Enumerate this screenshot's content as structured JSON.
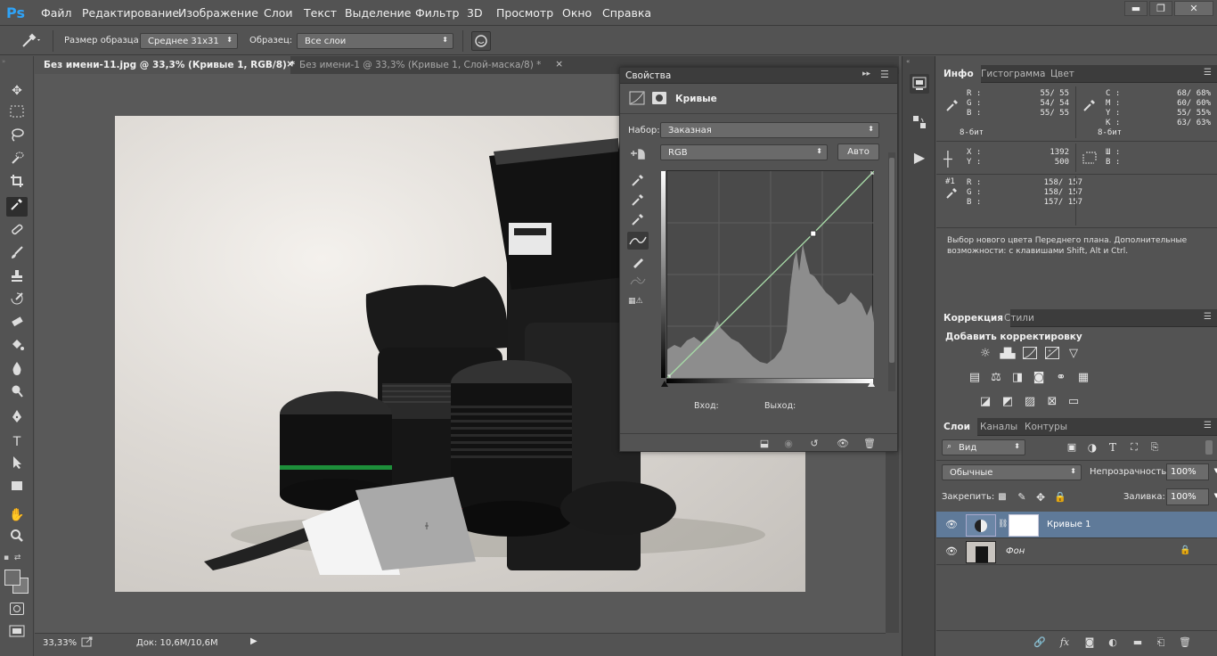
{
  "app": {
    "logo": "Ps"
  },
  "menu": [
    "Файл",
    "Редактирование",
    "Изображение",
    "Слои",
    "Текст",
    "Выделение",
    "Фильтр",
    "3D",
    "Просмотр",
    "Окно",
    "Справка"
  ],
  "window_buttons": {
    "minimize": "▬",
    "restore": "❐",
    "close": "✕"
  },
  "options": {
    "sample_size_label": "Размер образца:",
    "sample_size_value": "Среднее 31x31",
    "sample_label": "Образец:",
    "sample_value": "Все слои"
  },
  "tabs": [
    {
      "label": "Без имени-11.jpg @ 33,3% (Кривые 1, RGB/8) *",
      "close": "×"
    },
    {
      "label": "Без имени-1 @ 33,3% (Кривые 1, Слой-маска/8) *",
      "close": "×"
    }
  ],
  "status": {
    "zoom": "33,33%",
    "doc": "Док: 10,6M/10,6M"
  },
  "properties": {
    "title": "Свойства",
    "layer_name": "Кривые",
    "preset_label": "Набор:",
    "preset_value": "Заказная",
    "channel_value": "RGB",
    "auto_label": "Авто",
    "input_label": "Вход:",
    "output_label": "Выход:"
  },
  "info_panel": {
    "tabs": [
      "Инфо",
      "Гистограмма",
      "Цвет"
    ],
    "rgb": [
      {
        "l": "R :",
        "v": "55/  55"
      },
      {
        "l": "G :",
        "v": "54/  54"
      },
      {
        "l": "B :",
        "v": "55/  55"
      }
    ],
    "cmyk": [
      {
        "l": "C :",
        "v": "68/  68%"
      },
      {
        "l": "M :",
        "v": "60/  60%"
      },
      {
        "l": "Y :",
        "v": "55/  55%"
      },
      {
        "l": "K :",
        "v": "63/  63%"
      }
    ],
    "bit1": "8-бит",
    "bit2": "8-бит",
    "xy": [
      {
        "l": "X :",
        "v": "1392"
      },
      {
        "l": "Y :",
        "v": "500"
      }
    ],
    "wh": [
      {
        "l": "Ш :",
        "v": ""
      },
      {
        "l": "В :",
        "v": ""
      }
    ],
    "sampler_id": "#1",
    "sampler": [
      {
        "l": "R :",
        "v": "158/  157"
      },
      {
        "l": "G :",
        "v": "158/  157"
      },
      {
        "l": "B :",
        "v": "157/  157"
      }
    ],
    "hint": "Выбор нового цвета Переднего плана. Дополнительные возможности: с клавишами Shift, Alt и Ctrl."
  },
  "adjust_panel": {
    "tabs": [
      "Коррекция",
      "Стили"
    ],
    "heading": "Добавить корректировку"
  },
  "layers_panel": {
    "tabs": [
      "Слои",
      "Каналы",
      "Контуры"
    ],
    "filter_value": "Вид",
    "blend_value": "Обычные",
    "opacity_label": "Непрозрачность:",
    "opacity_value": "100%",
    "lock_label": "Закрепить:",
    "fill_label": "Заливка:",
    "fill_value": "100%",
    "layers": [
      {
        "name": "Кривые 1",
        "selected": true
      },
      {
        "name": "Фон",
        "selected": false
      }
    ]
  },
  "chart_data": {
    "type": "line",
    "title": "",
    "xlabel": "",
    "ylabel": "",
    "xlim": [
      0,
      255
    ],
    "ylim": [
      0,
      255
    ],
    "series": [
      {
        "x": [
          0,
          180,
          255
        ],
        "values": [
          0,
          178,
          255
        ]
      }
    ]
  },
  "colors": {
    "accent": "#2fa3f7",
    "selected_layer": "#5f7a99",
    "curve": "#a6d8a6"
  }
}
